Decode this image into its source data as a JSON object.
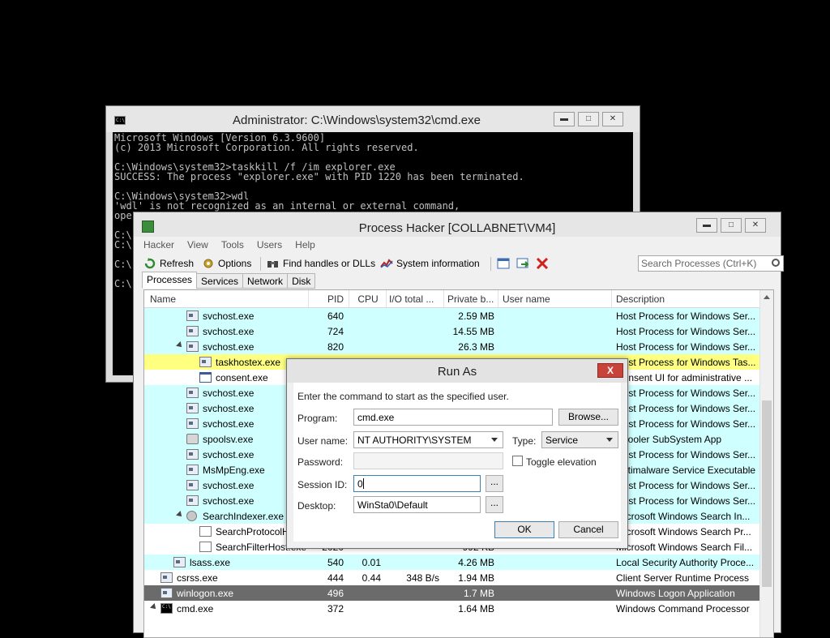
{
  "cmd": {
    "title": "Administrator: C:\\Windows\\system32\\cmd.exe",
    "icon": "cmd-icon",
    "lines": [
      "Microsoft Windows [Version 6.3.9600]",
      "(c) 2013 Microsoft Corporation. All rights reserved.",
      "",
      "C:\\Windows\\system32>taskkill /f /im explorer.exe",
      "SUCCESS: The process \"explorer.exe\" with PID 1220 has been terminated.",
      "",
      "C:\\Windows\\system32>wdl",
      "'wdl' is not recognized as an internal or external command,",
      "ope",
      "",
      "C:\\",
      "C:\\",
      "",
      "C:\\",
      "",
      "C:\\"
    ]
  },
  "ph": {
    "title": "Process Hacker [COLLABNET\\VM4]",
    "menu": [
      "Hacker",
      "View",
      "Tools",
      "Users",
      "Help"
    ],
    "toolbar": {
      "refresh": "Refresh",
      "options": "Options",
      "find_handles": "Find handles or DLLs",
      "system_info": "System information"
    },
    "search_placeholder": "Search Processes (Ctrl+K)",
    "tabs": [
      "Processes",
      "Services",
      "Network",
      "Disk"
    ],
    "columns": [
      "Name",
      "PID",
      "CPU",
      "I/O total ...",
      "Private b...",
      "User name",
      "Description"
    ],
    "rows": [
      {
        "name": "svchost.exe",
        "pid": "640",
        "cpu": "",
        "io": "",
        "priv": "2.59 MB",
        "user": "",
        "desc": "Host Process for Windows Ser..."
      },
      {
        "name": "svchost.exe",
        "pid": "724",
        "cpu": "",
        "io": "",
        "priv": "14.55 MB",
        "user": "",
        "desc": "Host Process for Windows Ser..."
      },
      {
        "name": "svchost.exe",
        "pid": "820",
        "cpu": "",
        "io": "",
        "priv": "26.3 MB",
        "user": "",
        "desc": "Host Process for Windows Ser..."
      },
      {
        "name": "taskhostex.exe",
        "pid": "",
        "cpu": "",
        "io": "",
        "priv": "",
        "user": "",
        "desc": "Host Process for Windows Tas..."
      },
      {
        "name": "consent.exe",
        "pid": "",
        "cpu": "",
        "io": "",
        "priv": "",
        "user": "",
        "desc": "Consent UI for administrative ..."
      },
      {
        "name": "svchost.exe",
        "pid": "",
        "cpu": "",
        "io": "",
        "priv": "",
        "user": "",
        "desc": "Host Process for Windows Ser..."
      },
      {
        "name": "svchost.exe",
        "pid": "",
        "cpu": "",
        "io": "",
        "priv": "",
        "user": "",
        "desc": "Host Process for Windows Ser..."
      },
      {
        "name": "svchost.exe",
        "pid": "",
        "cpu": "",
        "io": "",
        "priv": "",
        "user": "",
        "desc": "Host Process for Windows Ser..."
      },
      {
        "name": "spoolsv.exe",
        "pid": "",
        "cpu": "",
        "io": "",
        "priv": "",
        "user": "",
        "desc": "Spooler SubSystem App"
      },
      {
        "name": "svchost.exe",
        "pid": "",
        "cpu": "",
        "io": "",
        "priv": "",
        "user": "",
        "desc": "Host Process for Windows Ser..."
      },
      {
        "name": "MsMpEng.exe",
        "pid": "",
        "cpu": "",
        "io": "",
        "priv": "",
        "user": "",
        "desc": "Antimalware Service Executable"
      },
      {
        "name": "svchost.exe",
        "pid": "",
        "cpu": "",
        "io": "",
        "priv": "",
        "user": "",
        "desc": "Host Process for Windows Ser..."
      },
      {
        "name": "svchost.exe",
        "pid": "",
        "cpu": "",
        "io": "",
        "priv": "",
        "user": "",
        "desc": "Host Process for Windows Ser..."
      },
      {
        "name": "SearchIndexer.exe",
        "pid": "",
        "cpu": "",
        "io": "",
        "priv": "",
        "user": "",
        "desc": "Microsoft Windows Search In..."
      },
      {
        "name": "SearchProtocolH",
        "pid": "",
        "cpu": "",
        "io": "",
        "priv": "",
        "user": "",
        "desc": "Microsoft Windows Search Pr..."
      },
      {
        "name": "SearchFilterHost.exe",
        "pid": "2020",
        "cpu": "",
        "io": "",
        "priv": "992 KB",
        "user": "",
        "desc": "Microsoft Windows Search Fil..."
      },
      {
        "name": "lsass.exe",
        "pid": "540",
        "cpu": "0.01",
        "io": "",
        "priv": "4.26 MB",
        "user": "",
        "desc": "Local Security Authority Proce..."
      },
      {
        "name": "csrss.exe",
        "pid": "444",
        "cpu": "0.44",
        "io": "348 B/s",
        "priv": "1.94 MB",
        "user": "",
        "desc": "Client Server Runtime Process"
      },
      {
        "name": "winlogon.exe",
        "pid": "496",
        "cpu": "",
        "io": "",
        "priv": "1.7 MB",
        "user": "",
        "desc": "Windows Logon Application"
      },
      {
        "name": "cmd.exe",
        "pid": "372",
        "cpu": "",
        "io": "",
        "priv": "1.64 MB",
        "user": "",
        "desc": "Windows Command Processor"
      }
    ]
  },
  "runas": {
    "title": "Run As",
    "close_label": "X",
    "instruction": "Enter the command to start as the specified user.",
    "program_label": "Program:",
    "program_value": "cmd.exe",
    "browse_label": "Browse...",
    "username_label": "User name:",
    "username_value": "NT AUTHORITY\\SYSTEM",
    "type_label": "Type:",
    "type_value": "Service",
    "password_label": "Password:",
    "toggle_elevation_label": "Toggle elevation",
    "session_label": "Session ID:",
    "session_value": "0",
    "desktop_label": "Desktop:",
    "desktop_value": "WinSta0\\Default",
    "ellipsis": "...",
    "ok_label": "OK",
    "cancel_label": "Cancel"
  }
}
